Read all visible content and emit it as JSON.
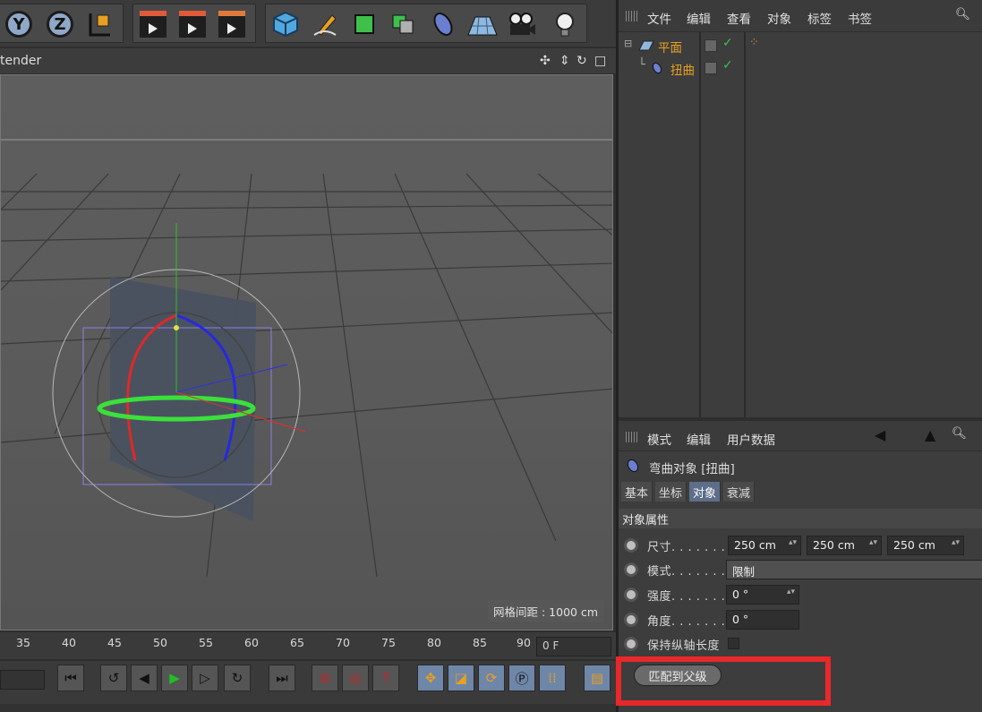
{
  "toolbar": {
    "axis_y": "Y",
    "axis_z": "Z"
  },
  "viewport": {
    "header_label": "tender",
    "grid_spacing": "网格间距 : 1000 cm"
  },
  "timeline": {
    "ticks": [
      "35",
      "40",
      "45",
      "50",
      "55",
      "60",
      "65",
      "70",
      "75",
      "80",
      "85",
      "90"
    ],
    "current_frame": "0 F"
  },
  "object_manager": {
    "menu": [
      "文件",
      "编辑",
      "查看",
      "对象",
      "标签",
      "书签"
    ],
    "objects": [
      {
        "name": "平面"
      },
      {
        "name": "扭曲"
      }
    ]
  },
  "attribute_manager": {
    "menu": [
      "模式",
      "编辑",
      "用户数据"
    ],
    "object_title": "弯曲对象 [扭曲]",
    "tabs": [
      "基本",
      "坐标",
      "对象",
      "衰减"
    ],
    "active_tab": "对象",
    "section_title": "对象属性",
    "props": {
      "size_label": "尺寸. . . . . . .",
      "size_x": "250 cm",
      "size_y": "250 cm",
      "size_z": "250 cm",
      "mode_label": "模式. . . . . . .",
      "mode_value": "限制",
      "strength_label": "强度. . . . . . .",
      "strength_value": "0 °",
      "angle_label": "角度. . . . . . .",
      "angle_value": "0 °",
      "keep_length_label": "保持纵轴长度"
    },
    "match_parent_button": "匹配到父级"
  },
  "colors": {
    "highlight": "#e8282a",
    "object_name": "#e8a020",
    "active_tab": "#5c6e8a"
  }
}
